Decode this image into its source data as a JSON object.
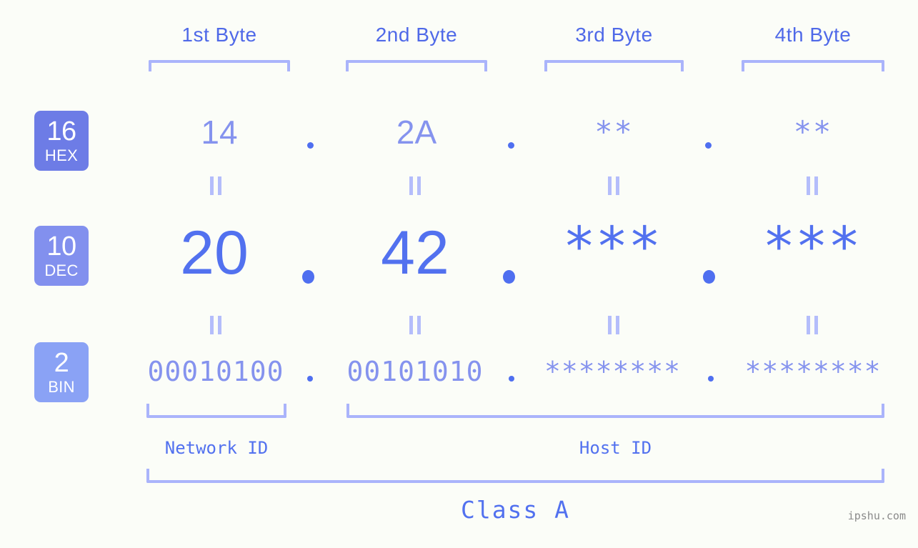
{
  "meta": {
    "watermark": "ipshu.com",
    "background_color": "#fbfdf8",
    "accent_color": "#5271ef",
    "accent_light_color": "#8593ee",
    "bracket_color": "#aab4fb"
  },
  "byte_headers": [
    {
      "label": "1st Byte"
    },
    {
      "label": "2nd Byte"
    },
    {
      "label": "3rd Byte"
    },
    {
      "label": "4th Byte"
    }
  ],
  "bases": [
    {
      "number": "16",
      "name": "HEX",
      "color": "#6d7ce6"
    },
    {
      "number": "10",
      "name": "DEC",
      "color": "#8290ee"
    },
    {
      "number": "2",
      "name": "BIN",
      "color": "#8aa2f5"
    }
  ],
  "rows": {
    "hex": {
      "base_number": "16",
      "base_name": "HEX",
      "values": [
        "14",
        "2A",
        "**",
        "**"
      ],
      "separators": [
        ".",
        ".",
        "."
      ]
    },
    "dec": {
      "base_number": "10",
      "base_name": "DEC",
      "values": [
        "20",
        "42",
        "***",
        "***"
      ],
      "separators": [
        ".",
        ".",
        "."
      ]
    },
    "bin": {
      "base_number": "2",
      "base_name": "BIN",
      "values": [
        "00010100",
        "00101010",
        "********",
        "********"
      ],
      "separators": [
        ".",
        ".",
        "."
      ]
    }
  },
  "equals_marks": {
    "symbol": "||",
    "count_per_gap": 4
  },
  "segments": {
    "network_id": "Network ID",
    "host_id": "Host ID",
    "class": "Class A"
  }
}
